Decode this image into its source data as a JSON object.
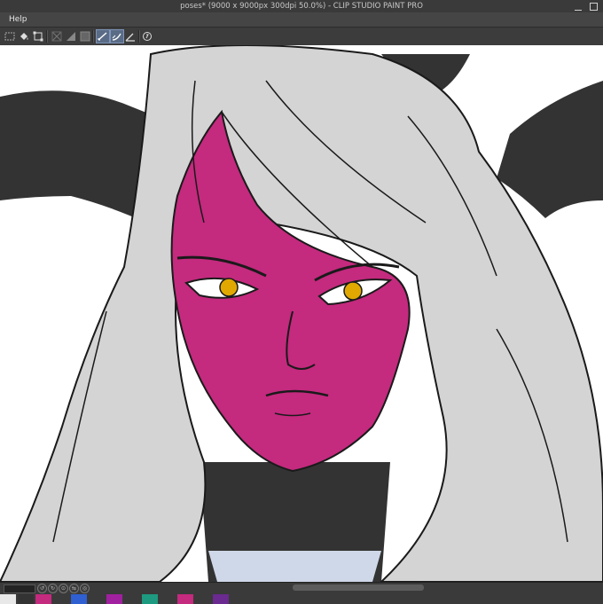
{
  "window": {
    "title": "poses* (9000 x 9000px 300dpi 50.0%)  - CLIP STUDIO PAINT PRO"
  },
  "menu": {
    "items": [
      "Help"
    ]
  },
  "toolbar": {
    "buttons": [
      "selection-fill-icon",
      "fill-bucket-icon",
      "transform-icon",
      "crop-icon",
      "gradient-icon",
      "layer-mask-icon",
      "ruler-snap-icon",
      "perspective-snap-icon",
      "angle-ruler-icon",
      "zoom-icon"
    ],
    "active": [
      "ruler-snap-icon",
      "perspective-snap-icon"
    ]
  },
  "colors": {
    "skin": "#c42a7e",
    "eyes": "#e0a800",
    "hair": "#d4d4d4",
    "horns": "#333333",
    "canvas": "#ffffff",
    "chrome": "#3a3a3a",
    "active_tool": "#5a6b86"
  },
  "canvas": {
    "zoom": "50.0%",
    "size": "9000 x 9000px",
    "dpi": "300dpi"
  },
  "bottom": {
    "nav_icons": [
      "rotate-left-icon",
      "rotate-right-icon",
      "reset-icon",
      "flip-icon",
      "mirror-icon"
    ],
    "swatch_colors": [
      "#e8e8e8",
      "#333333",
      "#c42a7e",
      "#3a3a3a",
      "#2f5fd0",
      "#3a3a3a",
      "#a020a0",
      "#3a3a3a",
      "#1e9a80",
      "#3a3a3a",
      "#c42a7e",
      "#3a3a3a",
      "#6a2a90",
      "#3a3a3a"
    ]
  }
}
